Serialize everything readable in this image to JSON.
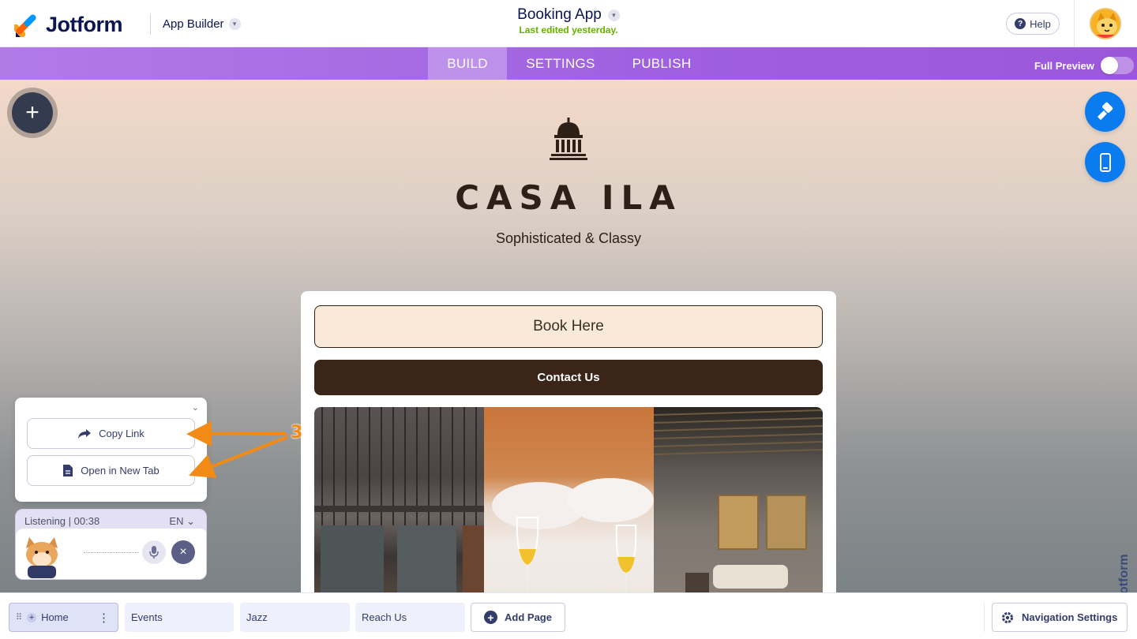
{
  "header": {
    "logo_text": "Jotform",
    "product": "App Builder",
    "app_title": "Booking App",
    "last_edited": "Last edited yesterday.",
    "help_label": "Help"
  },
  "nav": {
    "tabs": [
      {
        "label": "BUILD",
        "active": true
      },
      {
        "label": "SETTINGS",
        "active": false
      },
      {
        "label": "PUBLISH",
        "active": false
      }
    ],
    "full_preview_label": "Full Preview",
    "full_preview_on": false
  },
  "app": {
    "brand_name": "CASA ILA",
    "brand_tagline": "Sophisticated & Classy",
    "book_button": "Book Here",
    "contact_button": "Contact Us"
  },
  "share_popup": {
    "copy_link": "Copy Link",
    "open_new_tab": "Open in New Tab"
  },
  "annotation": {
    "number": "3",
    "color": "#f28b16"
  },
  "voice": {
    "status": "Listening | 00:38",
    "language": "EN"
  },
  "footer": {
    "pages": [
      {
        "label": "Home",
        "active": true
      },
      {
        "label": "Events",
        "active": false
      },
      {
        "label": "Jazz",
        "active": false
      },
      {
        "label": "Reach Us",
        "active": false
      }
    ],
    "add_page": "Add Page",
    "navigation_settings": "Navigation Settings"
  },
  "colors": {
    "nav_purple": "#9f5fe0",
    "accent_blue": "#0a7cf0",
    "brand_dark": "#3a2518",
    "book_fill": "#f9e9d9",
    "edited_green": "#64b200"
  }
}
